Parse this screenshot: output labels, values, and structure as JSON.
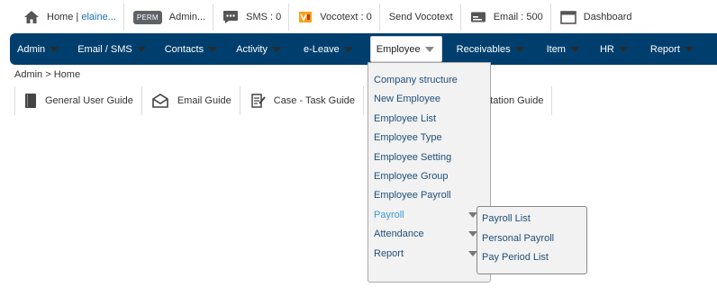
{
  "topbar": {
    "home_label": "Home |",
    "home_user": "elaine...",
    "perm_badge": "PERM",
    "admin_label": "Admin...",
    "sms_label": "SMS : 0",
    "vocotext_label": "Vocotext : 0",
    "send_vocotext_label": "Send Vocotext",
    "email_label": "Email : 500",
    "dashboard_label": "Dashboard"
  },
  "nav": {
    "items": [
      {
        "label": "Admin"
      },
      {
        "label": "Email / SMS"
      },
      {
        "label": "Contacts"
      },
      {
        "label": "Activity"
      },
      {
        "label": "e-Leave"
      },
      {
        "label": "Employee"
      },
      {
        "label": "Receivables"
      },
      {
        "label": "Item"
      },
      {
        "label": "HR"
      },
      {
        "label": "Report"
      }
    ]
  },
  "breadcrumb": "Admin > Home",
  "guides": [
    {
      "label": "General User Guide"
    },
    {
      "label": "Email Guide"
    },
    {
      "label": "Case - Task Guide"
    },
    {
      "label": "otation Guide"
    }
  ],
  "employee_menu": {
    "items": [
      {
        "label": "Company structure"
      },
      {
        "label": "New Employee"
      },
      {
        "label": "Employee List"
      },
      {
        "label": "Employee Type"
      },
      {
        "label": "Employee Setting"
      },
      {
        "label": "Employee Group"
      },
      {
        "label": "Employee Payroll"
      },
      {
        "label": "Payroll"
      },
      {
        "label": "Attendance"
      },
      {
        "label": "Report"
      }
    ]
  },
  "payroll_submenu": {
    "items": [
      {
        "label": "Payroll List"
      },
      {
        "label": "Personal Payroll"
      },
      {
        "label": "Pay Period List"
      }
    ]
  },
  "colors": {
    "navbar_bg": "#003f6d",
    "menu_link": "#1f4f7a",
    "menu_highlight": "#3d9ad6",
    "user_link": "#1b73b5"
  }
}
